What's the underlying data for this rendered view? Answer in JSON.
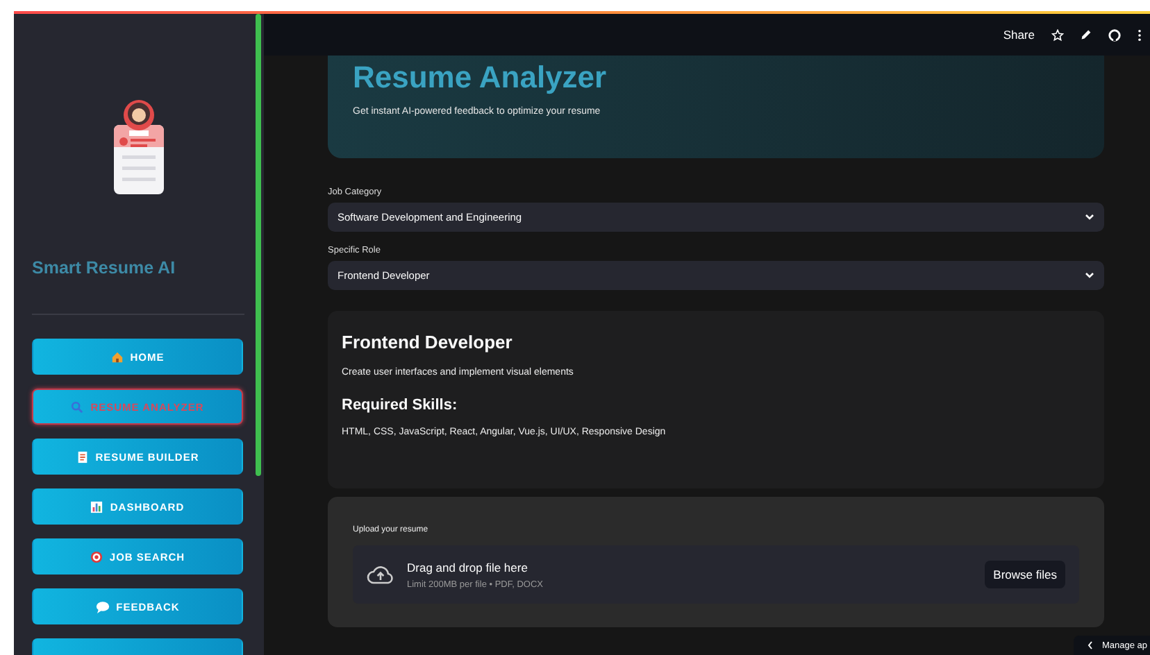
{
  "sidebar": {
    "title": "Smart Resume AI",
    "nav": [
      {
        "label": "HOME",
        "kind": "home",
        "selected": false
      },
      {
        "label": "RESUME ANALYZER",
        "kind": "search",
        "selected": true
      },
      {
        "label": "RESUME BUILDER",
        "kind": "document",
        "selected": false
      },
      {
        "label": "DASHBOARD",
        "kind": "chart",
        "selected": false
      },
      {
        "label": "JOB SEARCH",
        "kind": "target",
        "selected": false
      },
      {
        "label": "FEEDBACK",
        "kind": "chat",
        "selected": false
      }
    ]
  },
  "toolbar": {
    "share": "Share"
  },
  "hero": {
    "title": "Resume Analyzer",
    "subtitle": "Get instant AI-powered feedback to optimize your resume"
  },
  "fields": [
    {
      "label": "Job Category",
      "value": "Software Development and Engineering"
    },
    {
      "label": "Specific Role",
      "value": "Frontend Developer"
    }
  ],
  "role_card": {
    "title": "Frontend Developer",
    "description": "Create user interfaces and implement visual elements",
    "skills_heading": "Required Skills:",
    "skills": "HTML, CSS, JavaScript, React, Angular, Vue.js, UI/UX, Responsive Design"
  },
  "upload": {
    "label": "Upload your resume",
    "prompt": "Drag and drop file here",
    "limit": "Limit 200MB per file • PDF, DOCX",
    "button": "Browse files"
  },
  "manage_app": "Manage ap"
}
